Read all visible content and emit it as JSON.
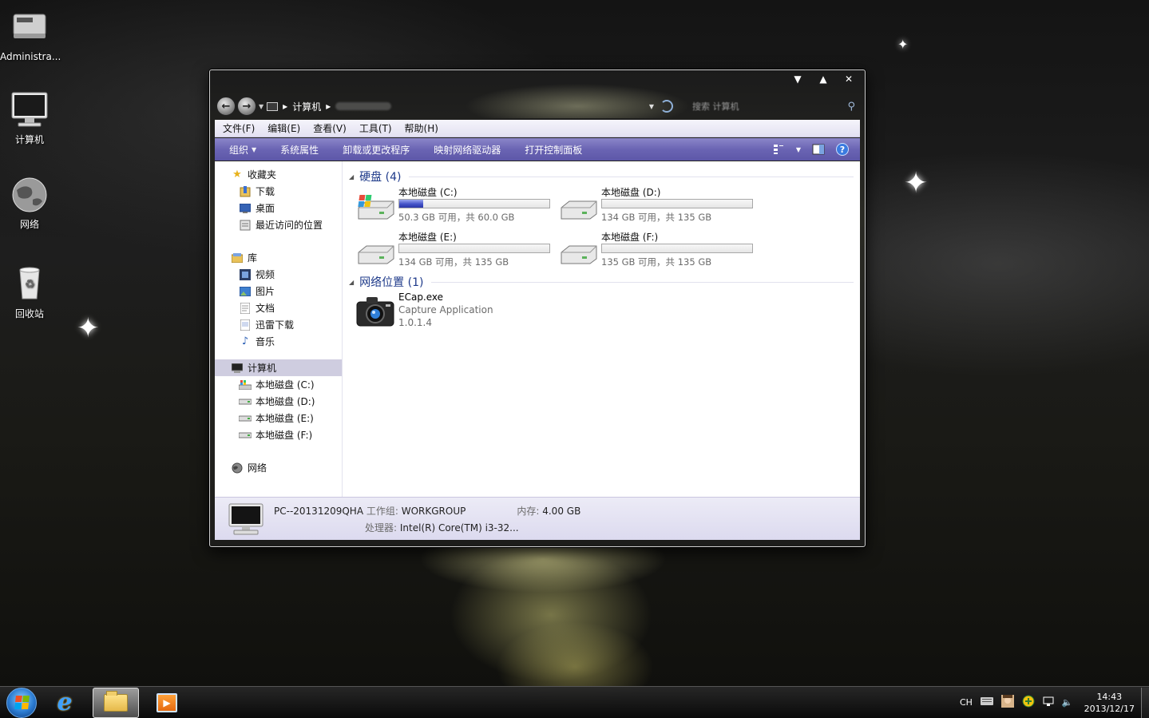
{
  "desktop": {
    "icons": [
      {
        "label": "Administra..."
      },
      {
        "label": "计算机"
      },
      {
        "label": "网络"
      },
      {
        "label": "回收站"
      }
    ]
  },
  "window": {
    "caption_buttons": [
      "▼",
      "▲",
      "✕"
    ],
    "address": {
      "crumbs": [
        "计算机"
      ],
      "search_placeholder": "搜索 计算机"
    },
    "menu": [
      "文件(F)",
      "编辑(E)",
      "查看(V)",
      "工具(T)",
      "帮助(H)"
    ],
    "toolbar": {
      "items": [
        "组织",
        "系统属性",
        "卸载或更改程序",
        "映射网络驱动器",
        "打开控制面板"
      ],
      "help": "?"
    },
    "nav": {
      "favorites": "收藏夹",
      "favorites_items": [
        "下载",
        "桌面",
        "最近访问的位置"
      ],
      "libraries": "库",
      "libraries_items": [
        "视频",
        "图片",
        "文档",
        "迅雷下载",
        "音乐"
      ],
      "computer": "计算机",
      "computer_items": [
        "本地磁盘 (C:)",
        "本地磁盘 (D:)",
        "本地磁盘 (E:)",
        "本地磁盘 (F:)"
      ],
      "network": "网络"
    },
    "content": {
      "drives_header": "硬盘 (4)",
      "drives": [
        {
          "name": "本地磁盘 (C:)",
          "free": "50.3 GB 可用，共 60.0 GB",
          "used_fraction": 0.16,
          "system": true
        },
        {
          "name": "本地磁盘 (D:)",
          "free": "134 GB 可用，共 135 GB",
          "used_fraction": 0.0,
          "system": false
        },
        {
          "name": "本地磁盘 (E:)",
          "free": "134 GB 可用，共 135 GB",
          "used_fraction": 0.0,
          "system": false
        },
        {
          "name": "本地磁盘 (F:)",
          "free": "135 GB 可用，共 135 GB",
          "used_fraction": 0.0,
          "system": false
        }
      ],
      "network_header": "网络位置 (1)",
      "network_item": {
        "name": "ECap.exe",
        "description": "Capture Application",
        "version": "1.0.1.4"
      }
    },
    "details": {
      "pc_name": "PC--20131209QHA",
      "workgroup_label": "工作组:",
      "workgroup": "WORKGROUP",
      "memory_label": "内存:",
      "memory": "4.00 GB",
      "cpu_label": "处理器:",
      "cpu": "Intel(R) Core(TM) i3-32..."
    }
  },
  "taskbar": {
    "tray_lang": "CH",
    "time": "14:43",
    "date": "2013/12/17"
  },
  "colors": {
    "toolbar": "#6a64b3",
    "menubar": "#e3e1f1",
    "group_header": "#1e3a8a",
    "drive_bar_fill": "#4453c8"
  }
}
